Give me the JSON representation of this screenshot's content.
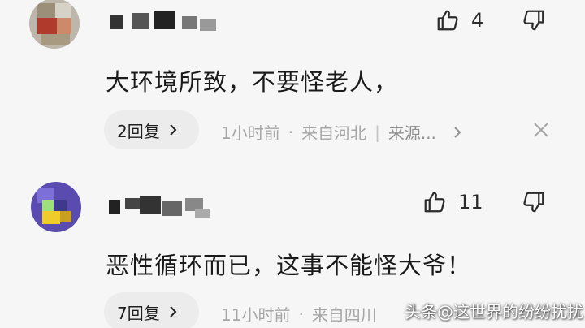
{
  "comments": [
    {
      "likes": "4",
      "text": "大环境所致，不要怪老人，",
      "replies": "2回复",
      "time": "1小时前",
      "dot": "·",
      "location": "来自河北",
      "divider": "|",
      "source": "来源..."
    },
    {
      "likes": "11",
      "text": "恶性循环而已，这事不能怪大爷！",
      "replies": "7回复",
      "time": "11小时前",
      "dot": "·",
      "location": "来自四川"
    }
  ],
  "watermark": "头条@这世界的纷纷扰扰",
  "icons": {
    "like": "thumbs-up-icon",
    "dislike": "thumbs-down-icon",
    "chevron": "chevron-right-icon",
    "close": "close-icon"
  },
  "colors": {
    "background": "#f6f6f6",
    "pill": "#ececec",
    "meta": "#a6a6a6"
  }
}
